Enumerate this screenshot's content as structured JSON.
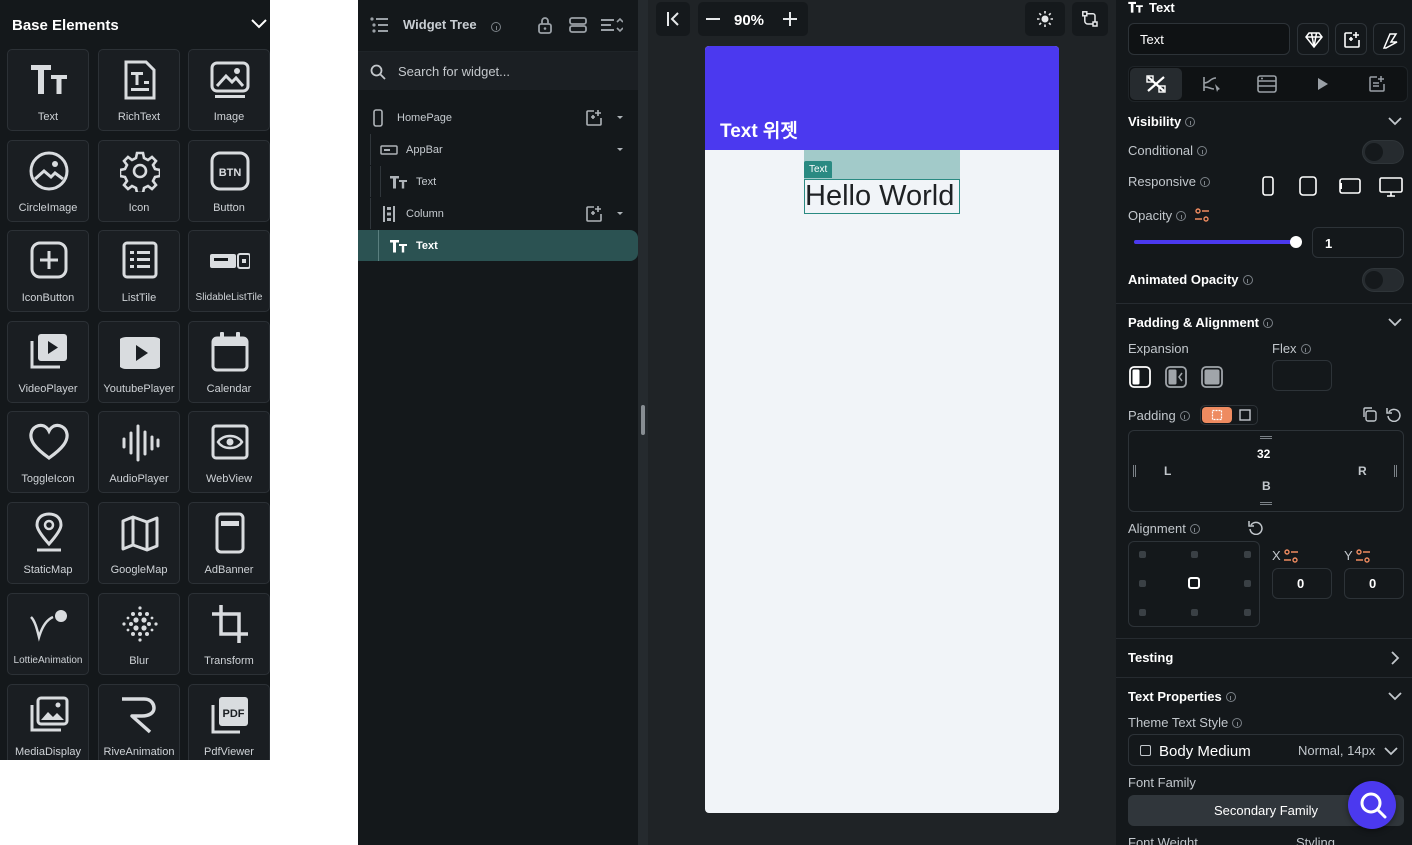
{
  "left_panel": {
    "title": "Base Elements",
    "tiles": [
      {
        "label": "Text",
        "icon": "text-icon"
      },
      {
        "label": "RichText",
        "icon": "rich-text-icon"
      },
      {
        "label": "Image",
        "icon": "image-icon"
      },
      {
        "label": "CircleImage",
        "icon": "circle-image-icon"
      },
      {
        "label": "Icon",
        "icon": "gear-icon"
      },
      {
        "label": "Button",
        "icon": "button-icon"
      },
      {
        "label": "IconButton",
        "icon": "icon-button-icon"
      },
      {
        "label": "ListTile",
        "icon": "list-tile-icon"
      },
      {
        "label": "SlidableListTile",
        "icon": "slidable-list-tile-icon"
      },
      {
        "label": "VideoPlayer",
        "icon": "video-player-icon"
      },
      {
        "label": "YoutubePlayer",
        "icon": "youtube-player-icon"
      },
      {
        "label": "Calendar",
        "icon": "calendar-icon"
      },
      {
        "label": "ToggleIcon",
        "icon": "heart-icon"
      },
      {
        "label": "AudioPlayer",
        "icon": "audio-wave-icon"
      },
      {
        "label": "WebView",
        "icon": "webview-eye-icon"
      },
      {
        "label": "StaticMap",
        "icon": "map-pin-icon"
      },
      {
        "label": "GoogleMap",
        "icon": "map-icon"
      },
      {
        "label": "AdBanner",
        "icon": "ad-banner-icon"
      },
      {
        "label": "LottieAnimation",
        "icon": "lottie-icon"
      },
      {
        "label": "Blur",
        "icon": "blur-icon"
      },
      {
        "label": "Transform",
        "icon": "crop-icon"
      },
      {
        "label": "MediaDisplay",
        "icon": "media-display-icon"
      },
      {
        "label": "RiveAnimation",
        "icon": "rive-icon"
      },
      {
        "label": "PdfViewer",
        "icon": "pdf-icon"
      }
    ]
  },
  "widget_tree": {
    "title": "Widget Tree",
    "search_placeholder": "Search for widget...",
    "nodes": [
      {
        "label": "HomePage",
        "icon": "phone-icon"
      },
      {
        "label": "AppBar",
        "icon": "appbar-icon"
      },
      {
        "label": "Text",
        "icon": "text-icon"
      },
      {
        "label": "Column",
        "icon": "column-icon"
      },
      {
        "label": "Text",
        "icon": "text-icon",
        "selected": true
      }
    ]
  },
  "canvas": {
    "zoom": "90%",
    "appbar_title": "Text 위젯",
    "selection_tag": "Text",
    "text_content": "Hello World"
  },
  "props": {
    "header_title": "Text",
    "name_value": "Text",
    "visibility": {
      "title": "Visibility",
      "conditional": "Conditional",
      "responsive": "Responsive",
      "opacity": "Opacity",
      "opacity_value": "1",
      "opacity_level": 1.0,
      "animated_opacity": "Animated Opacity"
    },
    "padding_alignment": {
      "title": "Padding & Alignment",
      "expansion": "Expansion",
      "flex": "Flex",
      "padding": "Padding",
      "pad_top": "32",
      "pad_left": "L",
      "pad_right": "R",
      "pad_bottom": "B",
      "alignment": "Alignment",
      "x_label": "X",
      "y_label": "Y",
      "x_value": "0",
      "y_value": "0"
    },
    "testing": "Testing",
    "text_properties": {
      "title": "Text Properties",
      "theme_text_style": "Theme Text Style",
      "style_name": "Body Medium",
      "style_detail": "Normal, 14px",
      "font_family": "Font Family",
      "font_family_value": "Secondary Family",
      "font_weight": "Font Weight",
      "styling": "Styling"
    }
  },
  "colors": {
    "accent": "#4b39ef",
    "selection": "#2a8a82",
    "panel_bg": "#14181b",
    "padding_active": "#ee8b60"
  }
}
